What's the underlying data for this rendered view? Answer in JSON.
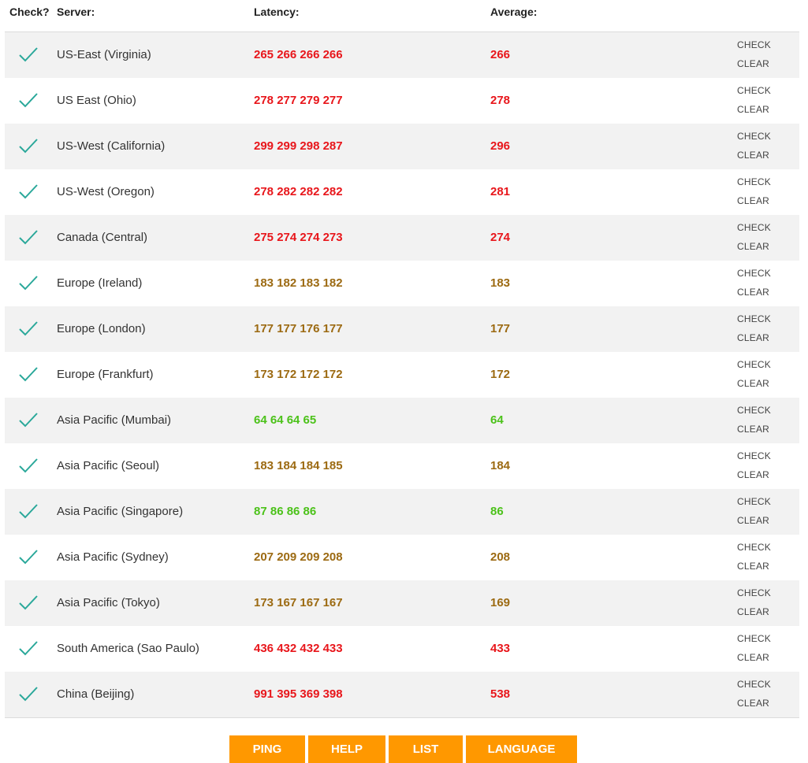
{
  "header": {
    "check": "Check?",
    "server": "Server:",
    "latency": "Latency:",
    "average": "Average:"
  },
  "colors": {
    "high": "#e8161b",
    "medium": "#9c6a12",
    "low": "#4cc21a",
    "checkmark": "#2aa89a",
    "button": "#ff9800"
  },
  "icons": {
    "row_status": "checkmark-icon"
  },
  "rows": [
    {
      "server": "US-East (Virginia)",
      "latency": "265 266 266 266",
      "average": "266",
      "level": "high",
      "check_label": "CHECK",
      "clear_label": "CLEAR"
    },
    {
      "server": "US East (Ohio)",
      "latency": "278 277 279 277",
      "average": "278",
      "level": "high",
      "check_label": "CHECK",
      "clear_label": "CLEAR"
    },
    {
      "server": "US-West (California)",
      "latency": "299 299 298 287",
      "average": "296",
      "level": "high",
      "check_label": "CHECK",
      "clear_label": "CLEAR"
    },
    {
      "server": "US-West (Oregon)",
      "latency": "278 282 282 282",
      "average": "281",
      "level": "high",
      "check_label": "CHECK",
      "clear_label": "CLEAR"
    },
    {
      "server": "Canada (Central)",
      "latency": "275 274 274 273",
      "average": "274",
      "level": "high",
      "check_label": "CHECK",
      "clear_label": "CLEAR"
    },
    {
      "server": "Europe (Ireland)",
      "latency": "183 182 183 182",
      "average": "183",
      "level": "medium",
      "check_label": "CHECK",
      "clear_label": "CLEAR"
    },
    {
      "server": "Europe (London)",
      "latency": "177 177 176 177",
      "average": "177",
      "level": "medium",
      "check_label": "CHECK",
      "clear_label": "CLEAR"
    },
    {
      "server": "Europe (Frankfurt)",
      "latency": "173 172 172 172",
      "average": "172",
      "level": "medium",
      "check_label": "CHECK",
      "clear_label": "CLEAR"
    },
    {
      "server": "Asia Pacific (Mumbai)",
      "latency": "64 64 64 65",
      "average": "64",
      "level": "low",
      "check_label": "CHECK",
      "clear_label": "CLEAR"
    },
    {
      "server": "Asia Pacific (Seoul)",
      "latency": "183 184 184 185",
      "average": "184",
      "level": "medium",
      "check_label": "CHECK",
      "clear_label": "CLEAR"
    },
    {
      "server": "Asia Pacific (Singapore)",
      "latency": "87 86 86 86",
      "average": "86",
      "level": "low",
      "check_label": "CHECK",
      "clear_label": "CLEAR"
    },
    {
      "server": "Asia Pacific (Sydney)",
      "latency": "207 209 209 208",
      "average": "208",
      "level": "medium",
      "check_label": "CHECK",
      "clear_label": "CLEAR"
    },
    {
      "server": "Asia Pacific (Tokyo)",
      "latency": "173 167 167 167",
      "average": "169",
      "level": "medium",
      "check_label": "CHECK",
      "clear_label": "CLEAR"
    },
    {
      "server": "South America (Sao Paulo)",
      "latency": "436 432 432 433",
      "average": "433",
      "level": "high",
      "check_label": "CHECK",
      "clear_label": "CLEAR"
    },
    {
      "server": "China (Beijing)",
      "latency": "991 395 369 398",
      "average": "538",
      "level": "high",
      "check_label": "CHECK",
      "clear_label": "CLEAR"
    }
  ],
  "buttons": {
    "ping": "PING",
    "help": "HELP",
    "list": "LIST",
    "language": "LANGUAGE"
  }
}
